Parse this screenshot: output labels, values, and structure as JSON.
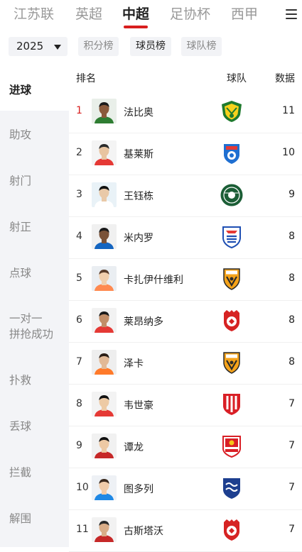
{
  "nav": {
    "tabs": [
      {
        "label": "江苏联"
      },
      {
        "label": "英超"
      },
      {
        "label": "中超"
      },
      {
        "label": "足协杯"
      },
      {
        "label": "西甲"
      }
    ],
    "active_tab": "中超"
  },
  "filters": {
    "season": "2025",
    "segments": [
      {
        "label": "积分榜"
      },
      {
        "label": "球员榜"
      },
      {
        "label": "球队榜"
      }
    ],
    "active_segment": "球员榜"
  },
  "sidebar": {
    "items": [
      {
        "label": "进球"
      },
      {
        "label": "助攻"
      },
      {
        "label": "射门"
      },
      {
        "label": "射正"
      },
      {
        "label": "点球"
      },
      {
        "label_line1": "一对一",
        "label_line2": "拼抢成功"
      },
      {
        "label": "扑救"
      },
      {
        "label": "丢球"
      },
      {
        "label": "拦截"
      },
      {
        "label": "解围"
      }
    ],
    "active": "进球"
  },
  "table": {
    "headers": {
      "rank": "排名",
      "team": "球队",
      "value": "数据"
    },
    "rows": [
      {
        "rank": "1",
        "name": "法比奥",
        "team_logo": "guoan-shield-logo",
        "value": "11"
      },
      {
        "rank": "2",
        "name": "基莱斯",
        "team_logo": "meizhou-logo",
        "value": "10"
      },
      {
        "rank": "3",
        "name": "王钰栋",
        "team_logo": "zhejiang-round-logo",
        "value": "9"
      },
      {
        "rank": "4",
        "name": "米内罗",
        "team_logo": "shenhua-logo",
        "value": "8"
      },
      {
        "rank": "5",
        "name": "卡扎伊什维利",
        "team_logo": "taishan-tsfc-logo",
        "value": "8"
      },
      {
        "rank": "6",
        "name": "莱昂纳多",
        "team_logo": "shanghai-port-logo",
        "value": "8"
      },
      {
        "rank": "7",
        "name": "泽卡",
        "team_logo": "taishan-tsfc-logo",
        "value": "8"
      },
      {
        "rank": "8",
        "name": "韦世豪",
        "team_logo": "chengdu-red-shield-logo",
        "value": "7"
      },
      {
        "rank": "9",
        "name": "谭龙",
        "team_logo": "changchun-yatai-logo",
        "value": "7"
      },
      {
        "rank": "10",
        "name": "图多列",
        "team_logo": "dalian-blue-logo",
        "value": "7"
      },
      {
        "rank": "11",
        "name": "古斯塔沃",
        "team_logo": "shanghai-port-logo",
        "value": "7"
      }
    ]
  },
  "colors": {
    "accent": "#d81e1e",
    "sidebar_bg": "#f3f4f7",
    "chip_bg": "#f2f3f6",
    "inactive_text": "#999999"
  }
}
